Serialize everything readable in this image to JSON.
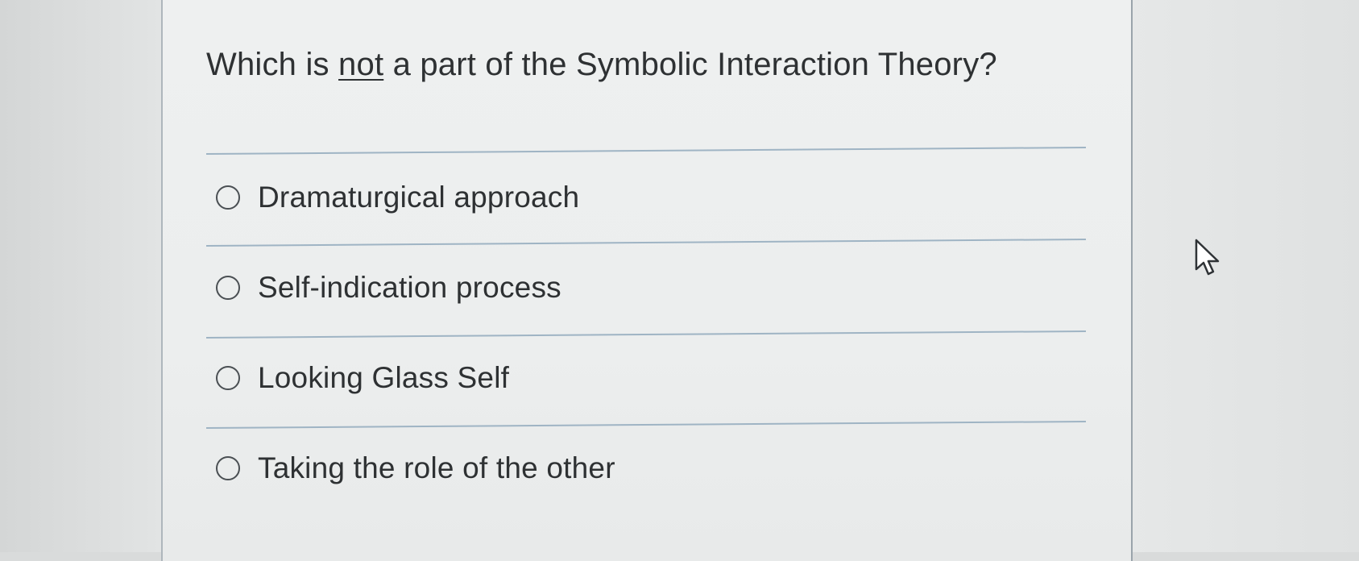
{
  "question": {
    "prefix": "Which is ",
    "emphasis": "not",
    "suffix": " a part of the Symbolic Interaction Theory?"
  },
  "options": [
    {
      "label": "Dramaturgical approach",
      "selected": false
    },
    {
      "label": "Self-indication process",
      "selected": false
    },
    {
      "label": "Looking Glass Self",
      "selected": false
    },
    {
      "label": "Taking the role of the other",
      "selected": false
    }
  ],
  "colors": {
    "text": "#2e3133",
    "divider": "#9fb4c4",
    "panel_border": "#9aa4ab"
  },
  "icons": {
    "pointer": "mouse-pointer-icon",
    "radio": "radio-button-icon"
  }
}
